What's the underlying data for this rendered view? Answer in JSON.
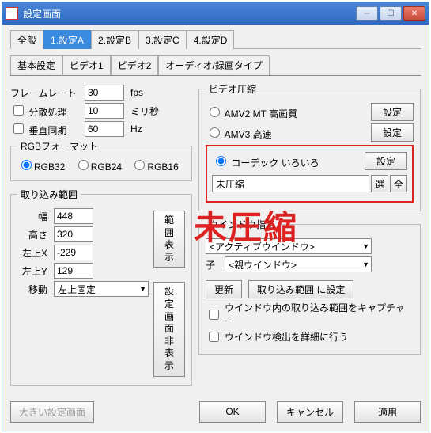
{
  "window": {
    "title": "設定画面"
  },
  "main_tabs": {
    "t0": "全般",
    "t1": "1.設定A",
    "t2": "2.設定B",
    "t3": "3.設定C",
    "t4": "4.設定D"
  },
  "sub_tabs": {
    "s0": "基本設定",
    "s1": "ビデオ1",
    "s2": "ビデオ2",
    "s3": "オーディオ/録画タイプ"
  },
  "left": {
    "framerate_label": "フレームレート",
    "framerate_value": "30",
    "framerate_unit": "fps",
    "distributed_label": "分散処理",
    "distributed_value": "10",
    "distributed_unit": "ミリ秒",
    "vsync_label": "垂直同期",
    "vsync_value": "60",
    "vsync_unit": "Hz",
    "rgb_group": "RGBフォーマット",
    "rgb32": "RGB32",
    "rgb24": "RGB24",
    "rgb16": "RGB16",
    "range_group": "取り込み範囲",
    "width_label": "幅",
    "width_value": "448",
    "height_label": "高さ",
    "height_value": "320",
    "lx_label": "左上X",
    "lx_value": "-229",
    "ly_label": "左上Y",
    "ly_value": "129",
    "move_label": "移動",
    "move_value": "左上固定",
    "show_range_btn": "範囲表示",
    "hide_settings_btn": "設定画面\n非表示"
  },
  "right": {
    "compress_group": "ビデオ圧縮",
    "opt1": "AMV2 MT 高画質",
    "opt2": "AMV3 高速",
    "opt3": "コーデック いろいろ",
    "setting_btn": "設定",
    "codec_value": "未圧縮",
    "codec_sel_btn": "選",
    "codec_all_btn": "全",
    "window_group": "ウインドウ指定",
    "window_value": "<アクティブウインドウ>",
    "child_label": "子",
    "child_value": "<親ウインドウ>",
    "update_btn": "更新",
    "set_range_btn": "取り込み範囲 に設定",
    "chk1": "ウインドウ内の取り込み範囲をキャプチャー",
    "chk2": "ウインドウ検出を詳細に行う"
  },
  "overlay": "未圧縮",
  "bottom": {
    "big_settings": "大きい設定画面",
    "ok": "OK",
    "cancel": "キャンセル",
    "apply": "適用"
  }
}
